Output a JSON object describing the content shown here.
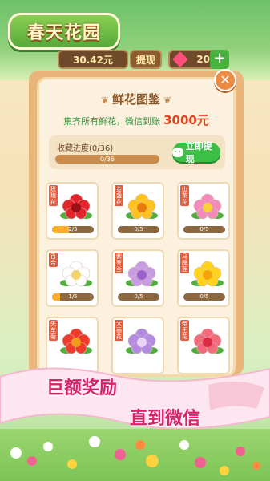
{
  "game": {
    "title": "春天花园",
    "money": "30.42元",
    "withdraw_short": "提现",
    "gems": "20",
    "plus": "+"
  },
  "modal": {
    "title": "鲜花图鉴",
    "subtitle": "集齐所有鲜花，微信到账",
    "reward": "3000元",
    "close": "✕",
    "progress_label": "收藏进度(0/36)",
    "progress_text": "0/36",
    "progress_fraction": 0,
    "withdraw_button": "立即提现"
  },
  "flowers": [
    {
      "name": "玫瑰花",
      "progress": "2/5",
      "fraction": 0.4,
      "color": "#e3262d",
      "center": "#9b0f17"
    },
    {
      "name": "金盏花",
      "progress": "0/5",
      "fraction": 0,
      "color": "#ffc21f",
      "center": "#e97b0a"
    },
    {
      "name": "山茶花",
      "progress": "0/5",
      "fraction": 0,
      "color": "#f38bb8",
      "center": "#f9d23a"
    },
    {
      "name": "百合",
      "progress": "1/5",
      "fraction": 0.2,
      "color": "#ffffff",
      "center": "#f1d46b"
    },
    {
      "name": "紫罗兰",
      "progress": "0/5",
      "fraction": 0,
      "color": "#c89ce0",
      "center": "#9b61c6"
    },
    {
      "name": "马蹄莲",
      "progress": "0/5",
      "fraction": 0,
      "color": "#ffd21c",
      "center": "#f5a50a"
    },
    {
      "name": "矢车菊",
      "progress": "",
      "fraction": 0,
      "color": "#ef3b2c",
      "center": "#f39b1a"
    },
    {
      "name": "大丽花",
      "progress": "",
      "fraction": 0,
      "color": "#b38be0",
      "center": "#e9d3f7"
    },
    {
      "name": "帝王花",
      "progress": "",
      "fraction": 0,
      "color": "#f26b7a",
      "center": "#d92d45"
    }
  ],
  "banner": {
    "line1": "巨额奖励",
    "line2": "直到微信"
  }
}
